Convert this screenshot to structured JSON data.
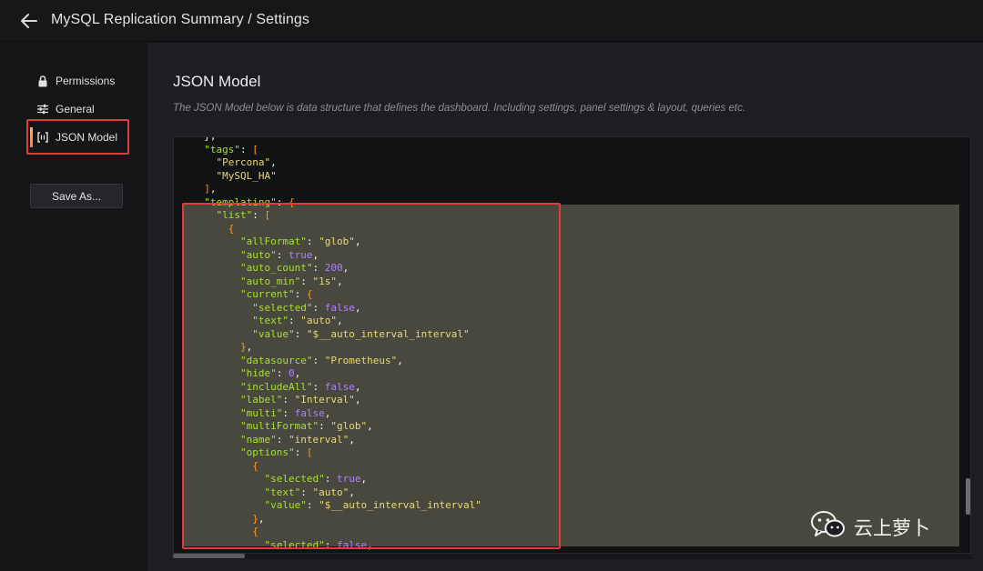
{
  "header": {
    "title": "MySQL Replication Summary / Settings"
  },
  "sidebar": {
    "items": [
      {
        "label": "Permissions",
        "icon": "lock-icon"
      },
      {
        "label": "General",
        "icon": "sliders-icon"
      },
      {
        "label": "JSON Model",
        "icon": "brackets-icon",
        "active": true
      }
    ],
    "save_as_label": "Save As..."
  },
  "main": {
    "title": "JSON Model",
    "description": "The JSON Model below is data structure that defines the dashboard. Including settings, panel settings & layout, queries etc."
  },
  "editor": {
    "lines": [
      [
        [
          "p",
          "  },"
        ]
      ],
      [
        [
          "p",
          "  "
        ],
        [
          "k",
          "\"tags\""
        ],
        [
          "p",
          ": "
        ],
        [
          "b",
          "["
        ]
      ],
      [
        [
          "p",
          "    "
        ],
        [
          "s",
          "\"Percona\""
        ],
        [
          "p",
          ","
        ]
      ],
      [
        [
          "p",
          "    "
        ],
        [
          "s",
          "\"MySQL_HA\""
        ]
      ],
      [
        [
          "p",
          "  "
        ],
        [
          "b",
          "]"
        ],
        [
          "p",
          ","
        ]
      ],
      [
        [
          "p",
          "  "
        ],
        [
          "k",
          "\"templating\""
        ],
        [
          "p",
          ": "
        ],
        [
          "b",
          "{"
        ]
      ],
      [
        [
          "p",
          "    "
        ],
        [
          "k",
          "\"list\""
        ],
        [
          "p",
          ": "
        ],
        [
          "b",
          "["
        ]
      ],
      [
        [
          "p",
          "      "
        ],
        [
          "b",
          "{"
        ]
      ],
      [
        [
          "p",
          "        "
        ],
        [
          "k",
          "\"allFormat\""
        ],
        [
          "p",
          ": "
        ],
        [
          "s",
          "\"glob\""
        ],
        [
          "p",
          ","
        ]
      ],
      [
        [
          "p",
          "        "
        ],
        [
          "k",
          "\"auto\""
        ],
        [
          "p",
          ": "
        ],
        [
          "n",
          "true"
        ],
        [
          "p",
          ","
        ]
      ],
      [
        [
          "p",
          "        "
        ],
        [
          "k",
          "\"auto_count\""
        ],
        [
          "p",
          ": "
        ],
        [
          "n",
          "200"
        ],
        [
          "p",
          ","
        ]
      ],
      [
        [
          "p",
          "        "
        ],
        [
          "k",
          "\"auto_min\""
        ],
        [
          "p",
          ": "
        ],
        [
          "s",
          "\"1s\""
        ],
        [
          "p",
          ","
        ]
      ],
      [
        [
          "p",
          "        "
        ],
        [
          "k",
          "\"current\""
        ],
        [
          "p",
          ": "
        ],
        [
          "b",
          "{"
        ]
      ],
      [
        [
          "p",
          "          "
        ],
        [
          "k",
          "\"selected\""
        ],
        [
          "p",
          ": "
        ],
        [
          "n",
          "false"
        ],
        [
          "p",
          ","
        ]
      ],
      [
        [
          "p",
          "          "
        ],
        [
          "k",
          "\"text\""
        ],
        [
          "p",
          ": "
        ],
        [
          "s",
          "\"auto\""
        ],
        [
          "p",
          ","
        ]
      ],
      [
        [
          "p",
          "          "
        ],
        [
          "k",
          "\"value\""
        ],
        [
          "p",
          ": "
        ],
        [
          "s",
          "\"$__auto_interval_interval\""
        ]
      ],
      [
        [
          "p",
          "        "
        ],
        [
          "b",
          "}"
        ],
        [
          "p",
          ","
        ]
      ],
      [
        [
          "p",
          "        "
        ],
        [
          "k",
          "\"datasource\""
        ],
        [
          "p",
          ": "
        ],
        [
          "s",
          "\"Prometheus\""
        ],
        [
          "p",
          ","
        ]
      ],
      [
        [
          "p",
          "        "
        ],
        [
          "k",
          "\"hide\""
        ],
        [
          "p",
          ": "
        ],
        [
          "n",
          "0"
        ],
        [
          "p",
          ","
        ]
      ],
      [
        [
          "p",
          "        "
        ],
        [
          "k",
          "\"includeAll\""
        ],
        [
          "p",
          ": "
        ],
        [
          "n",
          "false"
        ],
        [
          "p",
          ","
        ]
      ],
      [
        [
          "p",
          "        "
        ],
        [
          "k",
          "\"label\""
        ],
        [
          "p",
          ": "
        ],
        [
          "s",
          "\"Interval\""
        ],
        [
          "p",
          ","
        ]
      ],
      [
        [
          "p",
          "        "
        ],
        [
          "k",
          "\"multi\""
        ],
        [
          "p",
          ": "
        ],
        [
          "n",
          "false"
        ],
        [
          "p",
          ","
        ]
      ],
      [
        [
          "p",
          "        "
        ],
        [
          "k",
          "\"multiFormat\""
        ],
        [
          "p",
          ": "
        ],
        [
          "s",
          "\"glob\""
        ],
        [
          "p",
          ","
        ]
      ],
      [
        [
          "p",
          "        "
        ],
        [
          "k",
          "\"name\""
        ],
        [
          "p",
          ": "
        ],
        [
          "s",
          "\"interval\""
        ],
        [
          "p",
          ","
        ]
      ],
      [
        [
          "p",
          "        "
        ],
        [
          "k",
          "\"options\""
        ],
        [
          "p",
          ": "
        ],
        [
          "b",
          "["
        ]
      ],
      [
        [
          "p",
          "          "
        ],
        [
          "b",
          "{"
        ]
      ],
      [
        [
          "p",
          "            "
        ],
        [
          "k",
          "\"selected\""
        ],
        [
          "p",
          ": "
        ],
        [
          "n",
          "true"
        ],
        [
          "p",
          ","
        ]
      ],
      [
        [
          "p",
          "            "
        ],
        [
          "k",
          "\"text\""
        ],
        [
          "p",
          ": "
        ],
        [
          "s",
          "\"auto\""
        ],
        [
          "p",
          ","
        ]
      ],
      [
        [
          "p",
          "            "
        ],
        [
          "k",
          "\"value\""
        ],
        [
          "p",
          ": "
        ],
        [
          "s",
          "\"$__auto_interval_interval\""
        ]
      ],
      [
        [
          "p",
          "          "
        ],
        [
          "b",
          "}"
        ],
        [
          "p",
          ","
        ]
      ],
      [
        [
          "p",
          "          "
        ],
        [
          "b",
          "{"
        ]
      ],
      [
        [
          "p",
          "            "
        ],
        [
          "k",
          "\"selected\""
        ],
        [
          "p",
          ": "
        ],
        [
          "n",
          "false"
        ],
        [
          "p",
          ","
        ]
      ]
    ]
  },
  "watermark": {
    "text": "云上萝卜",
    "icon": "wechat-icon"
  },
  "colors": {
    "accent": "#ff7941",
    "annotation": "#e03c3c",
    "highlight": "#49483e",
    "key": "#a6e22e",
    "string": "#e6db74",
    "number": "#ae81ff"
  }
}
